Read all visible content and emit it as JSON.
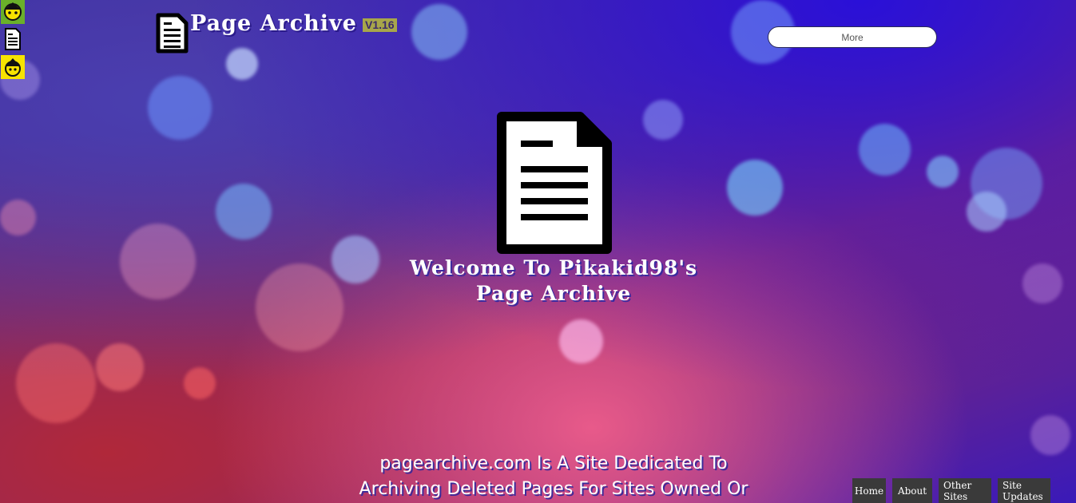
{
  "header": {
    "brand_title": "Page Archive",
    "version": "V1.16",
    "more_button_label": "More"
  },
  "sidebar": {
    "icons": [
      {
        "name": "avatar-icon"
      },
      {
        "name": "document-icon"
      },
      {
        "name": "avatar-icon"
      }
    ]
  },
  "hero": {
    "welcome_line1": "Welcome To Pikakid98's",
    "welcome_line2": "Page Archive",
    "description_line1": "pagearchive.com Is A Site Dedicated To",
    "description_line2": "Archiving Deleted Pages For Sites Owned Or"
  },
  "bottom_nav": {
    "items": [
      {
        "label": "Home"
      },
      {
        "label": "About"
      },
      {
        "label": "Other Sites"
      },
      {
        "label": "Site Updates"
      }
    ]
  },
  "colors": {
    "version_badge": "#a8a64a",
    "nav_button": "#3a3a3a",
    "text": "#ffffff"
  }
}
